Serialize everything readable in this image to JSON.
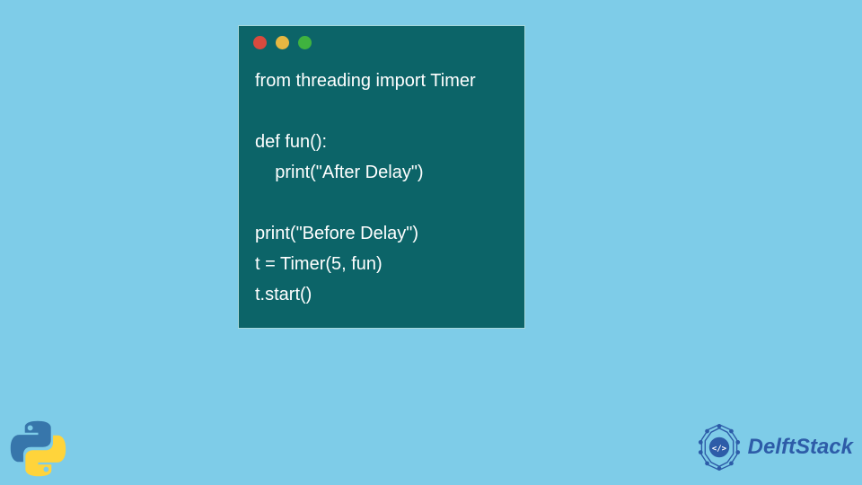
{
  "code": {
    "lines": [
      "from threading import Timer",
      "",
      "def fun():",
      "    print(\"After Delay\")",
      "",
      "print(\"Before Delay\")",
      "t = Timer(5, fun)",
      "t.start()"
    ]
  },
  "brand": {
    "name": "DelftStack"
  },
  "colors": {
    "background": "#7ecce8",
    "window": "#0c6468",
    "text": "#ffffff",
    "brand": "#2d5ca8"
  }
}
